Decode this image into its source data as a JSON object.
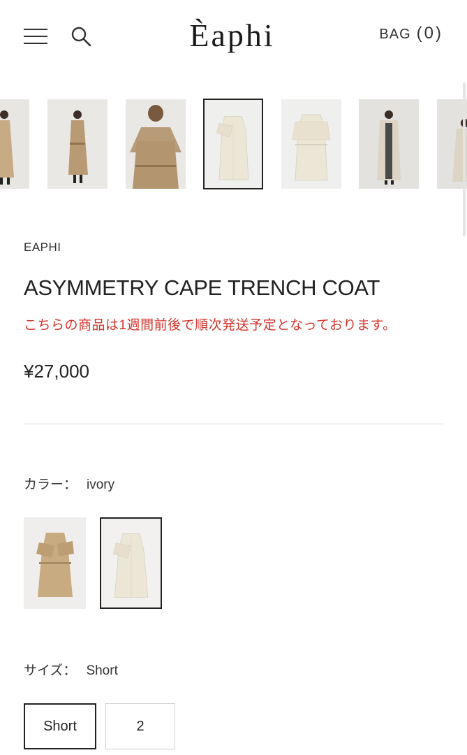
{
  "header": {
    "logo": "Èaphi",
    "bag_label": "BAG",
    "bag_count": "(0)"
  },
  "gallery": {
    "thumbnails": [
      {
        "name": "model-side-view",
        "tone": "#c7ab84"
      },
      {
        "name": "model-front-belted",
        "tone": "#b89a74"
      },
      {
        "name": "model-back-cape",
        "tone": "#b89c78"
      },
      {
        "name": "flat-ivory-front",
        "tone": "#ece6d6",
        "selected": true
      },
      {
        "name": "flat-ivory-back",
        "tone": "#ece6d6"
      },
      {
        "name": "model-ivory-open",
        "tone": "#dcd5c5"
      },
      {
        "name": "model-ivory-walking",
        "tone": "#dcd5c5"
      }
    ]
  },
  "product": {
    "brand": "EAPHI",
    "title": "ASYMMETRY CAPE TRENCH COAT",
    "notice": "こちらの商品は1週間前後で順次発送予定となっております。",
    "price": "¥27,000"
  },
  "color": {
    "label": "カラー：",
    "selected": "ivory",
    "swatches": [
      {
        "name": "beige",
        "tone": "#c9ab82"
      },
      {
        "name": "ivory",
        "tone": "#ece6d6",
        "selected": true
      }
    ]
  },
  "size": {
    "label": "サイズ：",
    "selected": "Short",
    "options": [
      "Short",
      "2"
    ]
  },
  "colors": {
    "notice": "#d2342c",
    "text": "#222222",
    "divider": "#d8d8d8"
  }
}
